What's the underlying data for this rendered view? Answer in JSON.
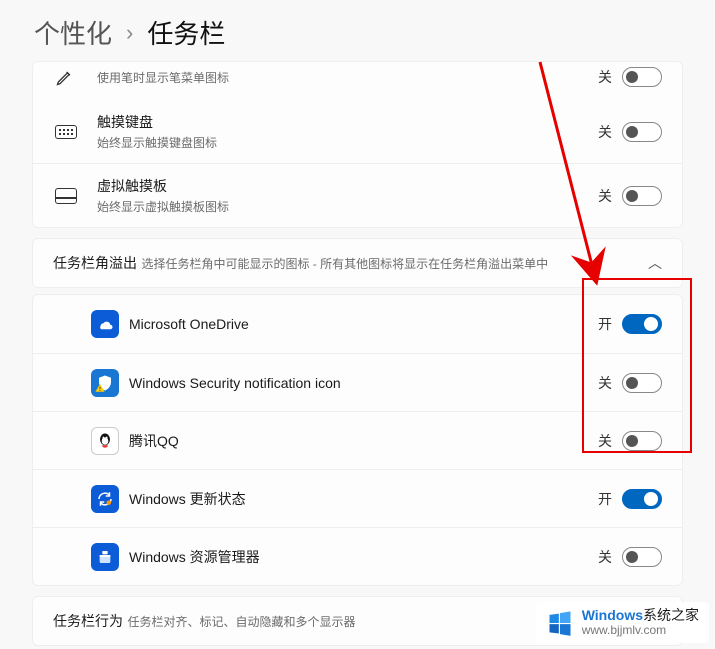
{
  "breadcrumb": {
    "parent": "个性化",
    "sep": "›",
    "current": "任务栏"
  },
  "status_labels": {
    "on": "开",
    "off": "关"
  },
  "pen_row": {
    "desc": "使用笔时显示笔菜单图标"
  },
  "rows_corner_icons": [
    {
      "id": "touch-keyboard",
      "title": "触摸键盘",
      "desc": "始终显示触摸键盘图标",
      "status": "off",
      "icon": "keyboard"
    },
    {
      "id": "virtual-touchpad",
      "title": "虚拟触摸板",
      "desc": "始终显示虚拟触摸板图标",
      "status": "off",
      "icon": "touchpad"
    }
  ],
  "overflow_section": {
    "title": "任务栏角溢出",
    "desc": "选择任务栏角中可能显示的图标 - 所有其他图标将显示在任务栏角溢出菜单中"
  },
  "overflow_items": [
    {
      "id": "onedrive",
      "label": "Microsoft OneDrive",
      "status": "on",
      "tile": "onedrive"
    },
    {
      "id": "winsec",
      "label": "Windows Security notification icon",
      "status": "off",
      "tile": "shield"
    },
    {
      "id": "qq",
      "label": "腾讯QQ",
      "status": "off",
      "tile": "qq"
    },
    {
      "id": "winupdate",
      "label": "Windows 更新状态",
      "status": "on",
      "tile": "update"
    },
    {
      "id": "explorer",
      "label": "Windows 资源管理器",
      "status": "off",
      "tile": "explorer"
    }
  ],
  "behaviors_section": {
    "title": "任务栏行为",
    "desc": "任务栏对齐、标记、自动隐藏和多个显示器"
  },
  "watermark": {
    "brand_html_prefix": "Windows",
    "brand_html_suffix": "系统之家",
    "url": "www.bjjmlv.com"
  },
  "colors": {
    "accent": "#0067c0",
    "annotation_red": "#e60000"
  }
}
